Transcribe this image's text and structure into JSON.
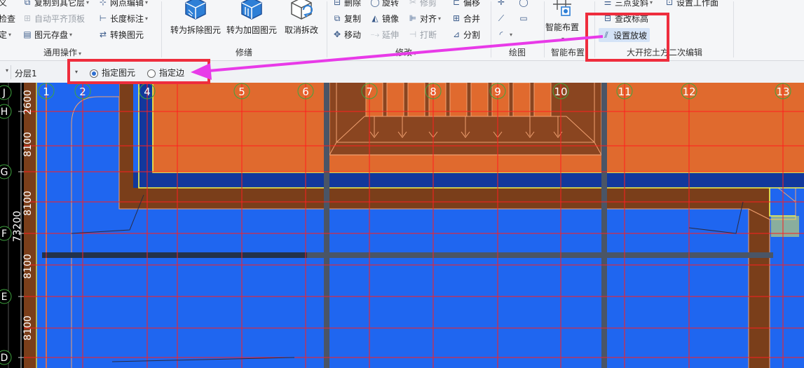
{
  "ribbon": {
    "general": {
      "row1": "复制到其它层",
      "row2": "自动平齐顶板",
      "row3": "图元存盘",
      "cut_left_1": "义",
      "cut_left_2": "检查",
      "cut_left_3": "定",
      "grid_edit": "网点编辑",
      "length_label": "长度标注",
      "convert": "转换图元",
      "group_label": "通用操作"
    },
    "repair": {
      "btn1": "转为拆除图元",
      "btn2": "转为加固图元",
      "btn3": "取消拆改",
      "group_label": "修缮"
    },
    "modify": {
      "delete": "删除",
      "rotate": "旋转",
      "trim": "修剪",
      "offset": "偏移",
      "copy": "复制",
      "mirror": "镜像",
      "align": "对齐",
      "merge": "合并",
      "move": "移动",
      "extend": "延伸",
      "break": "打断",
      "split": "分割",
      "group_label": "修改"
    },
    "draw": {
      "group_label": "绘图"
    },
    "smart": {
      "button": "智能布置",
      "group_label": "智能布置"
    },
    "excavation": {
      "three_point": "三点变斜",
      "set_workface": "设置工作面",
      "check_elev": "查改标高",
      "set_slope": "设置放坡",
      "group_label": "大开挖土方二次编辑"
    }
  },
  "options": {
    "layer": "分层1",
    "radio1": "指定图元",
    "radio2": "指定边",
    "radio1_selected": true
  },
  "canvas": {
    "top_axes": [
      "1",
      "2",
      "4",
      "5",
      "6",
      "7",
      "8",
      "9",
      "10",
      "11",
      "12",
      "13"
    ],
    "left_axes": [
      "J",
      "H",
      "G",
      "F",
      "E",
      "D"
    ],
    "dimensions": [
      "2600",
      "8100",
      "8100",
      "8100",
      "8100"
    ],
    "total_dimension": "73200"
  },
  "colors": {
    "highlight_red": "#ee2d3d",
    "arrow_magenta": "#e83ae8",
    "slab_blue": "#1f66f0",
    "beam_blue": "#12389c",
    "soil_orange": "#e06a2e",
    "brown": "#7a3e1a"
  }
}
